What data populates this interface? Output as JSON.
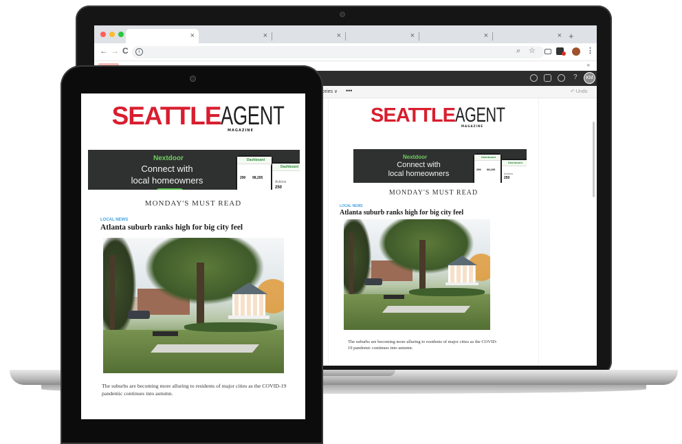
{
  "browser": {
    "tabs": [
      {
        "close": "×"
      },
      {
        "close": "×"
      },
      {
        "close": "×"
      },
      {
        "close": "×"
      },
      {
        "close": "×"
      },
      {
        "close": "×"
      }
    ],
    "new_tab": "+",
    "nav": {
      "back": "←",
      "forward": "→",
      "reload": "C"
    },
    "address_info": "i",
    "toolbar_icons": {
      "search": "⌕",
      "star": "☆",
      "menu": "⋮"
    },
    "bookmarks_right": "»"
  },
  "app_header": {
    "help": "?",
    "avatar_initials": "KM"
  },
  "subbar": {
    "categories_label": "egories ∨",
    "more_label": "•••",
    "undo_label": "↶ Undo"
  },
  "newsletter": {
    "logo_primary": "SEATTLE",
    "logo_secondary": "AGENT",
    "logo_magazine": "MAGAZINE",
    "ad": {
      "brand": "Nextdoor",
      "headline_line1": "Connect with",
      "headline_line2": "local homeowners",
      "phone_title": "Dashboard",
      "phone_stat1": "290",
      "phone_stat2": "98,205",
      "phone_label": "Actions",
      "phone_stat3": "250"
    },
    "section_title": "MONDAY'S MUST READ",
    "article": {
      "category": "LOCAL NEWS",
      "title": "Atlanta suburb ranks high for big city feel",
      "summary": "The suburbs are becoming more alluring to residents of major cities as the COVID-19 pandemic continues into autumn."
    }
  },
  "colors": {
    "brand_red": "#d81e2f",
    "link_blue": "#3da0e0",
    "nextdoor_green": "#6fcf5f",
    "device_black": "#0c0c0c"
  }
}
